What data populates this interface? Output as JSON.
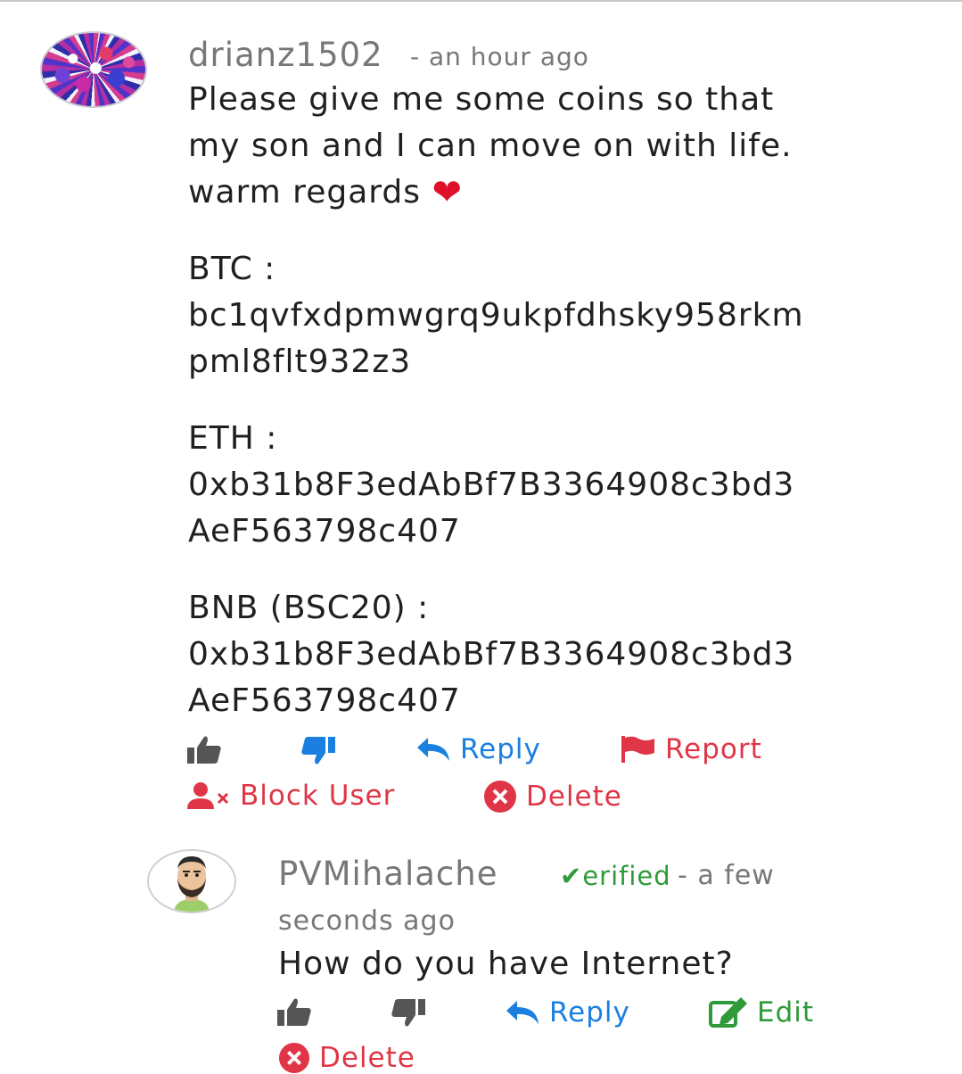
{
  "comment": {
    "author": "drianz1502",
    "time": "- an hour ago",
    "lines": [
      "Please give me some coins so that",
      "my son and I can move on with life.",
      "warm regards"
    ],
    "heart": "❤",
    "btc_label": "BTC :",
    "btc_line1": "bc1qvfxdpmwgrq9ukpfdhsky958rkm",
    "btc_line2": "pml8flt932z3",
    "eth_label": "ETH :",
    "eth_line1": "0xb31b8F3edAbBf7B3364908c3bd3",
    "eth_line2": "AeF563798c407",
    "bnb_label": "BNB (BSC20) :",
    "bnb_line1": "0xb31b8F3edAbBf7B3364908c3bd3",
    "bnb_line2": "AeF563798c407",
    "actions": {
      "reply": "Reply",
      "report": "Report",
      "block": "Block User",
      "delete": "Delete"
    }
  },
  "reply": {
    "author": "PVMihalache",
    "verified": "erified",
    "time_a": "- a few",
    "time_b": "seconds ago",
    "body": "How do you have Internet?",
    "actions": {
      "reply": "Reply",
      "edit": "Edit",
      "delete": "Delete"
    }
  },
  "colors": {
    "link_blue": "#1b7fe0",
    "danger_red": "#e03546",
    "verified_green": "#2f9a3a",
    "meta_gray": "#777777"
  }
}
